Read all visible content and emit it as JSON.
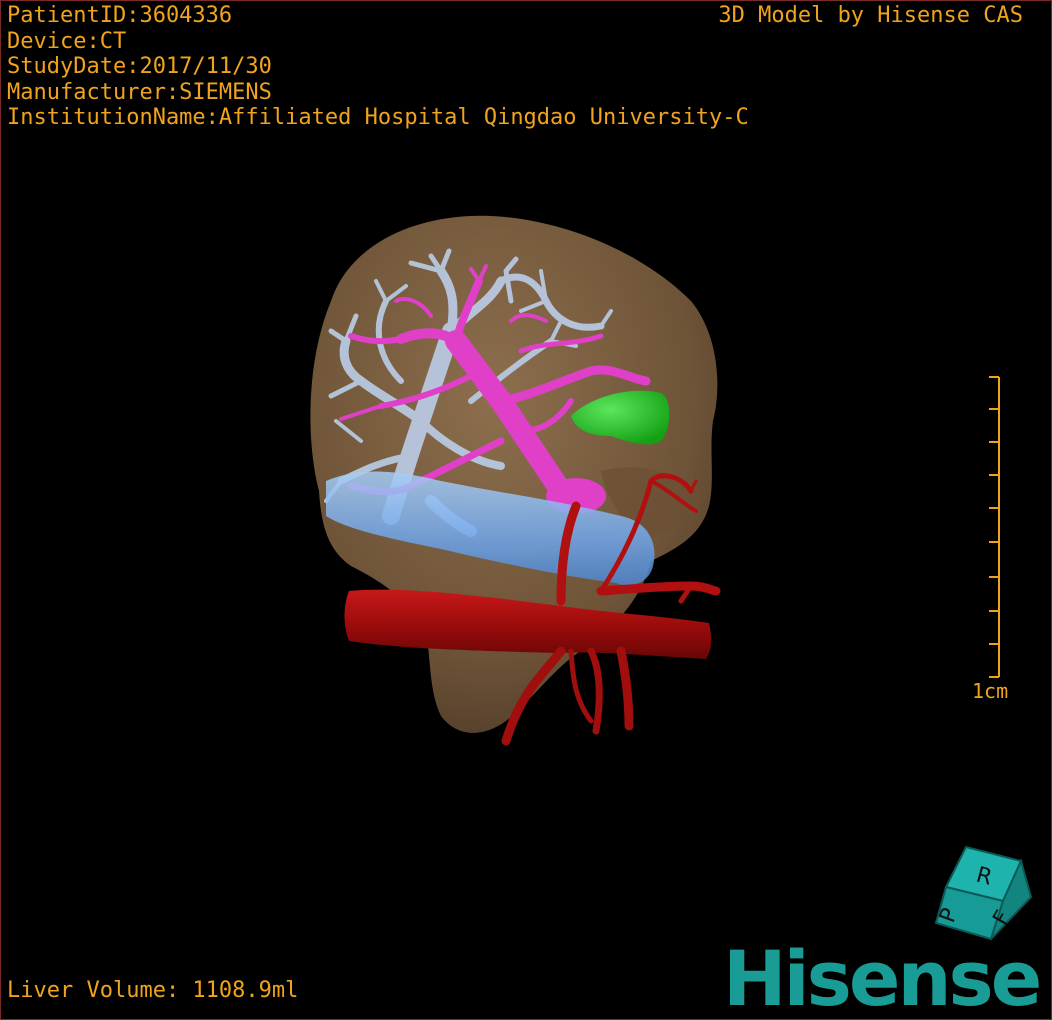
{
  "header": {
    "patient_id": "PatientID:3604336",
    "device": "Device:CT",
    "study_date": "StudyDate:2017/11/30",
    "manufacturer": "Manufacturer:SIEMENS",
    "institution": "InstitutionName:Affiliated Hospital Qingdao University-C",
    "model_credit": "3D Model by Hisense CAS"
  },
  "footer": {
    "liver_volume": "Liver Volume: 1108.9ml"
  },
  "scale_bar": {
    "label": "1cm"
  },
  "orientation_cube": {
    "faces": [
      "P",
      "R",
      "F"
    ]
  },
  "brand": {
    "logo_text": "Hisense"
  },
  "colors": {
    "overlay_text": "#f0a31c",
    "liver": "#8a6a45",
    "hepatic_vein": "#b8c8e0",
    "portal_vein": "#e040c8",
    "artery": "#b01010",
    "ivc": "#7ab0f0",
    "gallbladder": "#20c020",
    "logo": "#1a9c96"
  }
}
